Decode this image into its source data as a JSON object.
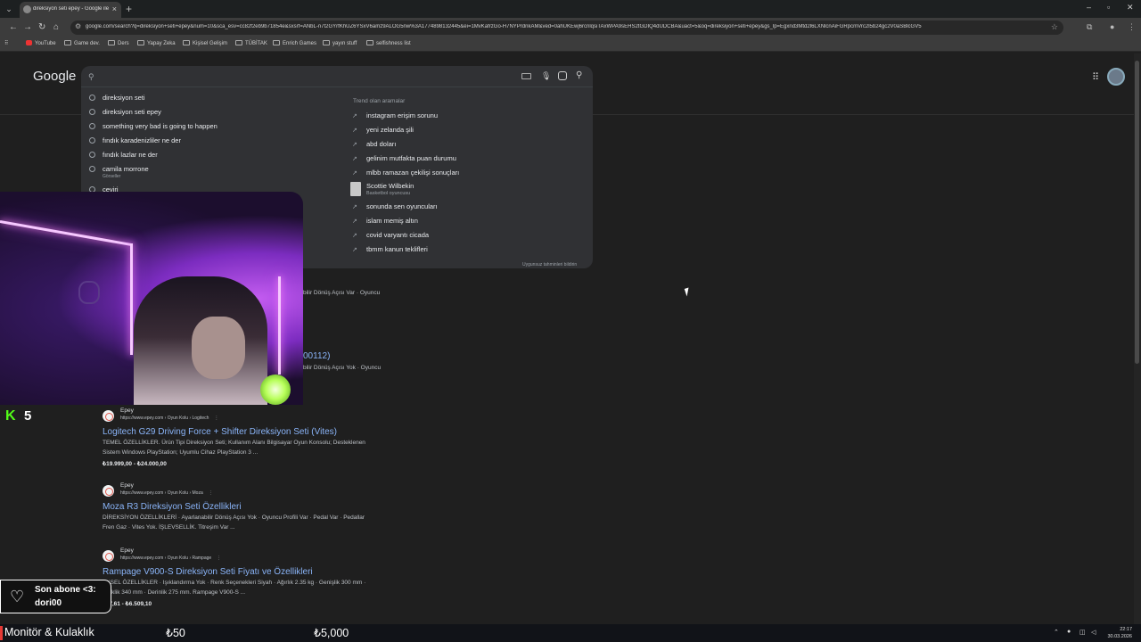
{
  "browser": {
    "tab_title": "direksiyon seti epey - Google ile",
    "url": "google.com/search?q=direksiyon+seti+epey&num=10&sca_esv=cc82f2eb9b71854e&sxsrf=ANbL-n7t2GYrfKhUZ6YSxV6amz9ALOG5nw%3A1774898132445&ei=1MvKafrzGo-H7NYPrdnkAM&ved=0ahUKEwj6rcnlqsiTAxWPA9sEHS2tGDIQ4dUDCBA&uact=5&oq=direksiyon+seti+epey&gs_lp=Egxnd3Mtd2l6LXNlcnAiFGRpcmVrc2l5b24gc2V0aSBlcGV5",
    "bookmarks": [
      "YouTube",
      "Game dev.",
      "Ders",
      "Yapay Zeka",
      "Kişisel Gelişim",
      "TÜBİTAK",
      "Enrich Games",
      "yayın stuff",
      "selfishness list"
    ]
  },
  "google": {
    "logo": "Google",
    "history": [
      {
        "label": "direksiyon seti"
      },
      {
        "label": "direksiyon seti epey"
      },
      {
        "label": "something very bad is going to happen"
      },
      {
        "label": "fındık karadenizliler ne der"
      },
      {
        "label": "fındık lazlar ne der"
      },
      {
        "label": "camila morrone",
        "sub": "Görseller"
      },
      {
        "label": "çeviri"
      }
    ],
    "trending_heading": "Trend olan aramalar",
    "trending": [
      "instagram erişim sorunu",
      "yeni zelanda şili",
      "abd doları",
      "gelinim mutfakta puan durumu",
      "mlbb ramazan çekilişi sonuçları"
    ],
    "trending_person": {
      "name": "Scottie Wilbekin",
      "sub": "Basketbol oyuncusu"
    },
    "trending_more": [
      "sonunda sen oyuncuları",
      "islam memiş altın",
      "covid varyantı cicada",
      "tbmm kanun teklifleri"
    ],
    "report_link": "Uygunsuz tahminleri bildirin",
    "partials": {
      "line1": "bilir Dönüş Açısı Var · Oyuncu",
      "link2": "00112)",
      "line2": "bilir Dönüş Açısı Yok · Oyuncu"
    },
    "results": [
      {
        "site": "Epey",
        "url": "https://www.epey.com › Oyun Kolu › Logitech",
        "title": "Logitech G29 Driving Force + Shifter Direksiyon Seti (Vites)",
        "snippet1": "TEMEL ÖZELLİKLER. Ürün Tipi Direksiyon Seti; Kullanım Alanı Bilgisayar Oyun Konsolu; Desteklenen",
        "snippet2": "Sistem Windows PlayStation; Uyumlu Cihaz PlayStation 3 ...",
        "price": "₺19.999,00 - ₺24.000,00"
      },
      {
        "site": "Epey",
        "url": "https://www.epey.com › Oyun Kolu › Moza",
        "title": "Moza R3 Direksiyon Seti Özellikleri",
        "snippet1": "DİREKSİYON ÖZELLİKLERİ · Ayarlanabilir Dönüş Açısı Yok · Oyuncu Profili Var · Pedal Var · Pedallar",
        "snippet2": "Fren Gaz · Vites Yok. İŞLEVSELLİK. Titreşim Var ..."
      },
      {
        "site": "Epey",
        "url": "https://www.epey.com › Oyun Kolu › Rampage",
        "title": "Rampage V900-S Direksiyon Seti Fiyatı ve Özellikleri",
        "snippet1": "EKSEL ÖZELLİKLER · Işıklandırma Yok · Renk Seçenekleri Siyah · Ağırlık 2.35 kg · Genişlik 300 mm ·",
        "snippet2": "kseklik 340 mm · Derinlik 275 mm. Rampage V900-S ...",
        "price": "087,61 - ₺6.509,10"
      }
    ]
  },
  "overlay": {
    "kick_count": "5",
    "sub_label": "Son abone <3:",
    "sub_name": "dori00",
    "ticker_item": "Monitör & Kulaklık",
    "ticker_price1": "₺50",
    "ticker_price2": "₺5,000"
  },
  "taskbar": {
    "time": "22:17",
    "date": "30.03.2026"
  },
  "colors": {
    "link": "#8ab4f8",
    "kick_green": "#53fc18",
    "page_bg": "#1f1f1f"
  }
}
